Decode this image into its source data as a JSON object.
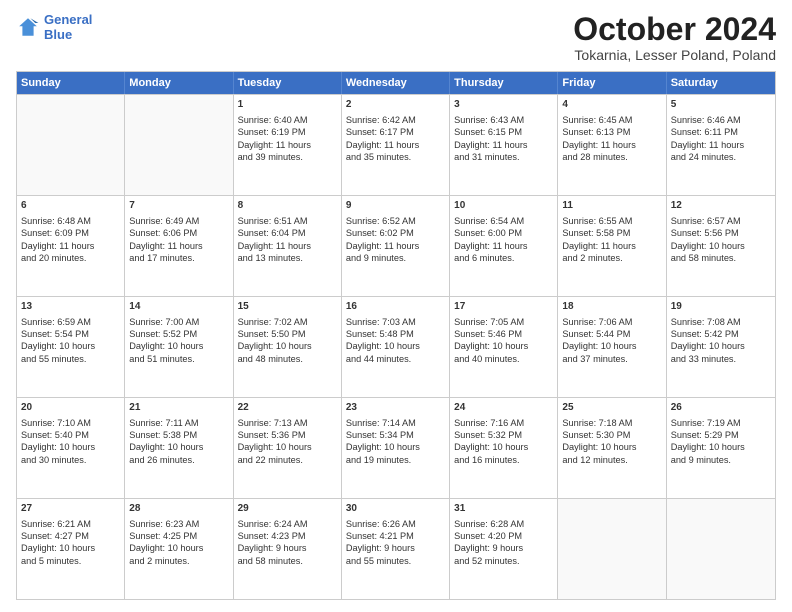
{
  "header": {
    "logo_line1": "General",
    "logo_line2": "Blue",
    "month": "October 2024",
    "location": "Tokarnia, Lesser Poland, Poland"
  },
  "days_of_week": [
    "Sunday",
    "Monday",
    "Tuesday",
    "Wednesday",
    "Thursday",
    "Friday",
    "Saturday"
  ],
  "rows": [
    [
      {
        "day": "",
        "empty": true
      },
      {
        "day": "",
        "empty": true
      },
      {
        "day": "1",
        "lines": [
          "Sunrise: 6:40 AM",
          "Sunset: 6:19 PM",
          "Daylight: 11 hours",
          "and 39 minutes."
        ]
      },
      {
        "day": "2",
        "lines": [
          "Sunrise: 6:42 AM",
          "Sunset: 6:17 PM",
          "Daylight: 11 hours",
          "and 35 minutes."
        ]
      },
      {
        "day": "3",
        "lines": [
          "Sunrise: 6:43 AM",
          "Sunset: 6:15 PM",
          "Daylight: 11 hours",
          "and 31 minutes."
        ]
      },
      {
        "day": "4",
        "lines": [
          "Sunrise: 6:45 AM",
          "Sunset: 6:13 PM",
          "Daylight: 11 hours",
          "and 28 minutes."
        ]
      },
      {
        "day": "5",
        "lines": [
          "Sunrise: 6:46 AM",
          "Sunset: 6:11 PM",
          "Daylight: 11 hours",
          "and 24 minutes."
        ]
      }
    ],
    [
      {
        "day": "6",
        "lines": [
          "Sunrise: 6:48 AM",
          "Sunset: 6:09 PM",
          "Daylight: 11 hours",
          "and 20 minutes."
        ]
      },
      {
        "day": "7",
        "lines": [
          "Sunrise: 6:49 AM",
          "Sunset: 6:06 PM",
          "Daylight: 11 hours",
          "and 17 minutes."
        ]
      },
      {
        "day": "8",
        "lines": [
          "Sunrise: 6:51 AM",
          "Sunset: 6:04 PM",
          "Daylight: 11 hours",
          "and 13 minutes."
        ]
      },
      {
        "day": "9",
        "lines": [
          "Sunrise: 6:52 AM",
          "Sunset: 6:02 PM",
          "Daylight: 11 hours",
          "and 9 minutes."
        ]
      },
      {
        "day": "10",
        "lines": [
          "Sunrise: 6:54 AM",
          "Sunset: 6:00 PM",
          "Daylight: 11 hours",
          "and 6 minutes."
        ]
      },
      {
        "day": "11",
        "lines": [
          "Sunrise: 6:55 AM",
          "Sunset: 5:58 PM",
          "Daylight: 11 hours",
          "and 2 minutes."
        ]
      },
      {
        "day": "12",
        "lines": [
          "Sunrise: 6:57 AM",
          "Sunset: 5:56 PM",
          "Daylight: 10 hours",
          "and 58 minutes."
        ]
      }
    ],
    [
      {
        "day": "13",
        "lines": [
          "Sunrise: 6:59 AM",
          "Sunset: 5:54 PM",
          "Daylight: 10 hours",
          "and 55 minutes."
        ]
      },
      {
        "day": "14",
        "lines": [
          "Sunrise: 7:00 AM",
          "Sunset: 5:52 PM",
          "Daylight: 10 hours",
          "and 51 minutes."
        ]
      },
      {
        "day": "15",
        "lines": [
          "Sunrise: 7:02 AM",
          "Sunset: 5:50 PM",
          "Daylight: 10 hours",
          "and 48 minutes."
        ]
      },
      {
        "day": "16",
        "lines": [
          "Sunrise: 7:03 AM",
          "Sunset: 5:48 PM",
          "Daylight: 10 hours",
          "and 44 minutes."
        ]
      },
      {
        "day": "17",
        "lines": [
          "Sunrise: 7:05 AM",
          "Sunset: 5:46 PM",
          "Daylight: 10 hours",
          "and 40 minutes."
        ]
      },
      {
        "day": "18",
        "lines": [
          "Sunrise: 7:06 AM",
          "Sunset: 5:44 PM",
          "Daylight: 10 hours",
          "and 37 minutes."
        ]
      },
      {
        "day": "19",
        "lines": [
          "Sunrise: 7:08 AM",
          "Sunset: 5:42 PM",
          "Daylight: 10 hours",
          "and 33 minutes."
        ]
      }
    ],
    [
      {
        "day": "20",
        "lines": [
          "Sunrise: 7:10 AM",
          "Sunset: 5:40 PM",
          "Daylight: 10 hours",
          "and 30 minutes."
        ]
      },
      {
        "day": "21",
        "lines": [
          "Sunrise: 7:11 AM",
          "Sunset: 5:38 PM",
          "Daylight: 10 hours",
          "and 26 minutes."
        ]
      },
      {
        "day": "22",
        "lines": [
          "Sunrise: 7:13 AM",
          "Sunset: 5:36 PM",
          "Daylight: 10 hours",
          "and 22 minutes."
        ]
      },
      {
        "day": "23",
        "lines": [
          "Sunrise: 7:14 AM",
          "Sunset: 5:34 PM",
          "Daylight: 10 hours",
          "and 19 minutes."
        ]
      },
      {
        "day": "24",
        "lines": [
          "Sunrise: 7:16 AM",
          "Sunset: 5:32 PM",
          "Daylight: 10 hours",
          "and 16 minutes."
        ]
      },
      {
        "day": "25",
        "lines": [
          "Sunrise: 7:18 AM",
          "Sunset: 5:30 PM",
          "Daylight: 10 hours",
          "and 12 minutes."
        ]
      },
      {
        "day": "26",
        "lines": [
          "Sunrise: 7:19 AM",
          "Sunset: 5:29 PM",
          "Daylight: 10 hours",
          "and 9 minutes."
        ]
      }
    ],
    [
      {
        "day": "27",
        "lines": [
          "Sunrise: 6:21 AM",
          "Sunset: 4:27 PM",
          "Daylight: 10 hours",
          "and 5 minutes."
        ]
      },
      {
        "day": "28",
        "lines": [
          "Sunrise: 6:23 AM",
          "Sunset: 4:25 PM",
          "Daylight: 10 hours",
          "and 2 minutes."
        ]
      },
      {
        "day": "29",
        "lines": [
          "Sunrise: 6:24 AM",
          "Sunset: 4:23 PM",
          "Daylight: 9 hours",
          "and 58 minutes."
        ]
      },
      {
        "day": "30",
        "lines": [
          "Sunrise: 6:26 AM",
          "Sunset: 4:21 PM",
          "Daylight: 9 hours",
          "and 55 minutes."
        ]
      },
      {
        "day": "31",
        "lines": [
          "Sunrise: 6:28 AM",
          "Sunset: 4:20 PM",
          "Daylight: 9 hours",
          "and 52 minutes."
        ]
      },
      {
        "day": "",
        "empty": true
      },
      {
        "day": "",
        "empty": true
      }
    ]
  ]
}
